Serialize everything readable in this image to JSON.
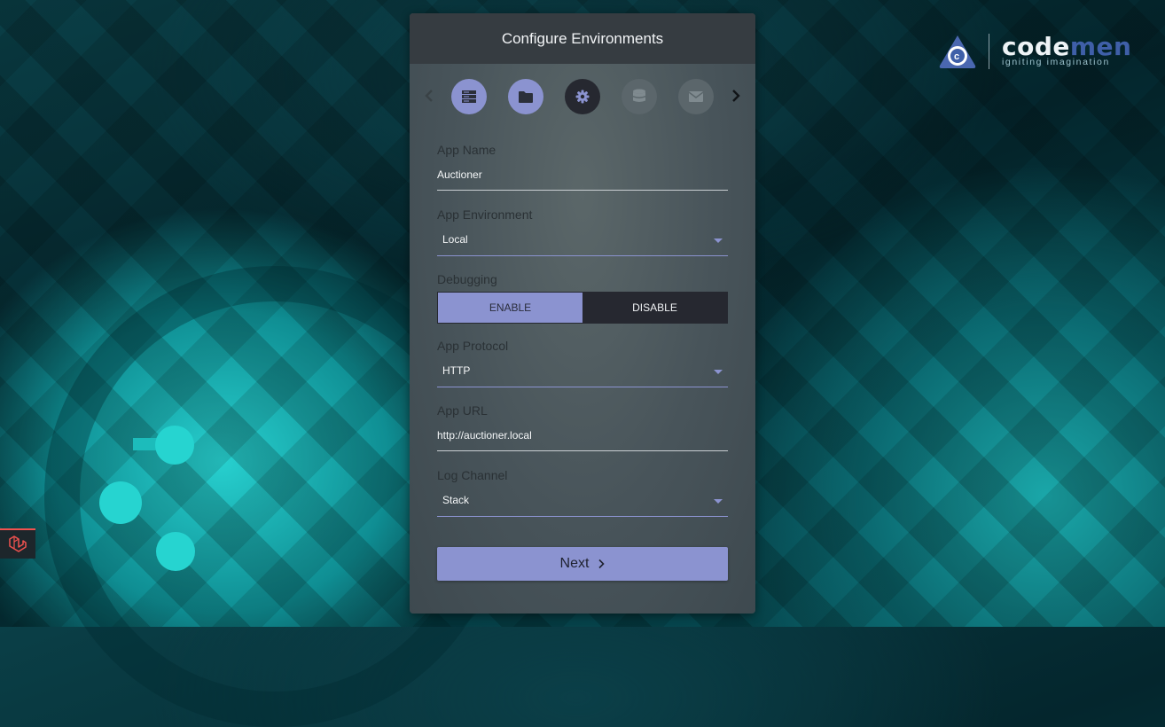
{
  "header": {
    "title": "Configure Environments"
  },
  "brand": {
    "name_part1": "code",
    "name_part2": "men",
    "tagline": "igniting imagination"
  },
  "steps": {
    "items": [
      {
        "icon": "server-icon",
        "state": "done"
      },
      {
        "icon": "folder-icon",
        "state": "done"
      },
      {
        "icon": "gear-icon",
        "state": "active"
      },
      {
        "icon": "database-icon",
        "state": "pending"
      },
      {
        "icon": "envelope-icon",
        "state": "pending"
      }
    ]
  },
  "form": {
    "app_name": {
      "label": "App Name",
      "value": "Auctioner"
    },
    "app_env": {
      "label": "App Environment",
      "value": "Local"
    },
    "debugging": {
      "label": "Debugging",
      "enable": "ENABLE",
      "disable": "DISABLE",
      "selected": "ENABLE"
    },
    "app_protocol": {
      "label": "App Protocol",
      "value": "HTTP"
    },
    "app_url": {
      "label": "App URL",
      "value": "http://auctioner.local"
    },
    "log_channel": {
      "label": "Log Channel",
      "value": "Stack"
    }
  },
  "actions": {
    "next_label": "Next",
    "next_icon": "chevron-right-icon"
  },
  "colors": {
    "accent": "#8b93d0",
    "card": "#48545a",
    "header": "#363c41",
    "dark": "#262830"
  }
}
